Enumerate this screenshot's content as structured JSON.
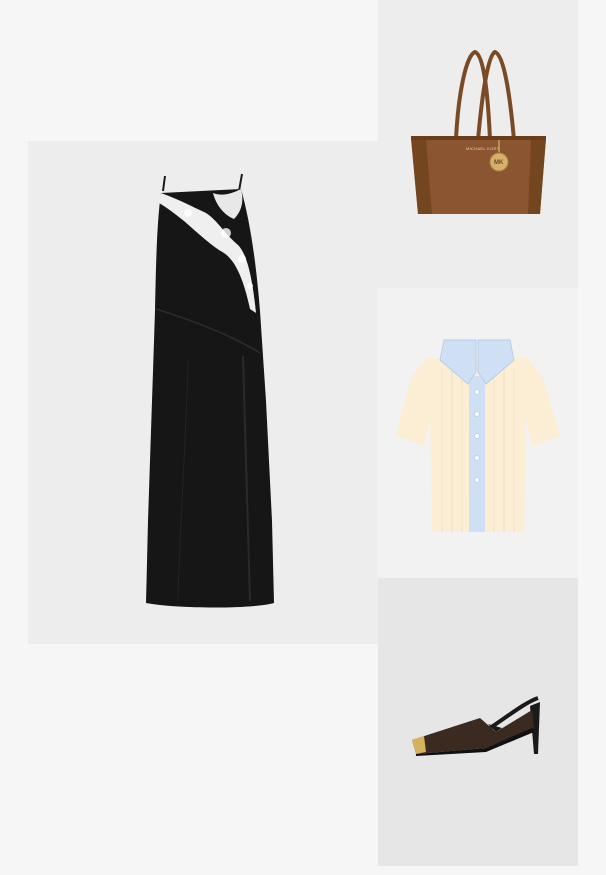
{
  "products": [
    {
      "name": "dress"
    },
    {
      "name": "tote-bag",
      "brand_label": "MICHAEL KORS",
      "logo": "MK"
    },
    {
      "name": "knit-polo"
    },
    {
      "name": "slingback-pump"
    }
  ],
  "colors": {
    "page_background": "#f6f6f6",
    "tile_background": "#ededed",
    "dress": "#151515",
    "lace": "#f2f2f2",
    "bag": "#8a5530",
    "knit": "#fbeed5",
    "collar": "#cfe0f5",
    "shoe": "#3a2a20",
    "gold": "#d6b25a"
  }
}
